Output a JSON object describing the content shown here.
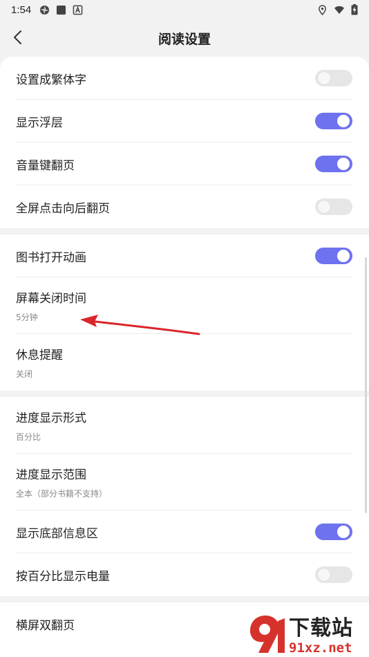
{
  "status_bar": {
    "time": "1:54",
    "left_icons": [
      "shutter-icon",
      "square-icon",
      "a-box-icon"
    ],
    "right_icons": [
      "location-icon",
      "wifi-icon",
      "battery-charging-icon"
    ]
  },
  "app_bar": {
    "title": "阅读设置",
    "back_icon": "chevron-left-icon"
  },
  "sections": [
    {
      "rows": [
        {
          "label": "设置成繁体字",
          "toggle": false
        },
        {
          "label": "显示浮层",
          "toggle": true
        },
        {
          "label": "音量键翻页",
          "toggle": true
        },
        {
          "label": "全屏点击向后翻页",
          "toggle": false
        }
      ]
    },
    {
      "rows": [
        {
          "label": "图书打开动画",
          "toggle": true
        },
        {
          "label": "屏幕关闭时间",
          "subtitle": "5分钟"
        },
        {
          "label": "休息提醒",
          "subtitle": "关闭"
        }
      ]
    },
    {
      "rows": [
        {
          "label": "进度显示形式",
          "subtitle": "百分比"
        },
        {
          "label": "进度显示范围",
          "subtitle": "全本（部分书籍不支持）"
        },
        {
          "label": "显示底部信息区",
          "toggle": true
        },
        {
          "label": "按百分比显示电量",
          "toggle": false
        }
      ]
    },
    {
      "rows": [
        {
          "label": "横屏双翻页"
        }
      ]
    }
  ],
  "watermark": {
    "title": "下载站",
    "domain": "91xz.net"
  },
  "colors": {
    "toggle_on": "#6e72ee",
    "toggle_off": "#e6e6e6",
    "annotation_arrow": "#d9262a",
    "watermark_red": "#d6322c"
  }
}
